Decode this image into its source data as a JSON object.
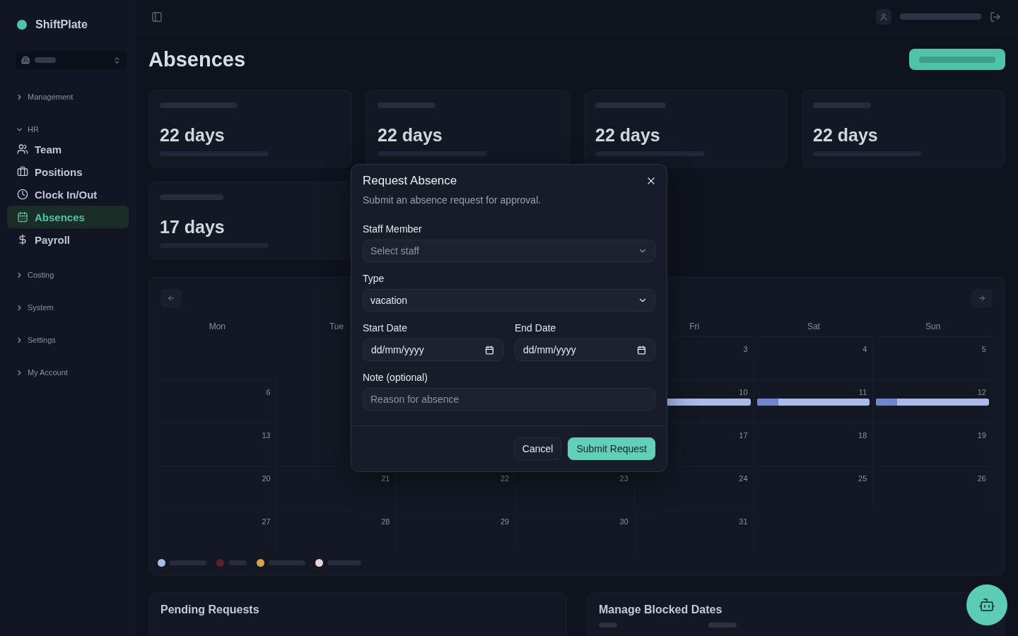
{
  "sidebar": {
    "brand": "ShiftPlate",
    "groups": [
      {
        "label": "Management",
        "expanded": false
      },
      {
        "label": "HR",
        "expanded": true,
        "items": [
          {
            "label": "Team",
            "selected": false
          },
          {
            "label": "Positions",
            "selected": false
          },
          {
            "label": "Clock In/Out",
            "selected": false
          },
          {
            "label": "Absences",
            "selected": true
          },
          {
            "label": "Payroll",
            "selected": false
          }
        ]
      },
      {
        "label": "Costing",
        "expanded": false
      },
      {
        "label": "System",
        "expanded": false
      },
      {
        "label": "Settings",
        "expanded": false
      },
      {
        "label": "My Account",
        "expanded": false
      }
    ]
  },
  "page": {
    "title": "Absences"
  },
  "balances": [
    {
      "days": "22 days"
    },
    {
      "days": "22 days"
    },
    {
      "days": "22 days"
    },
    {
      "days": "22 days"
    },
    {
      "days": "17 days"
    }
  ],
  "calendar": {
    "weekdays": {
      "mon": "Mon",
      "tue": "Tue",
      "fri": "Fri",
      "sat": "Sat",
      "sun": "Sun"
    },
    "weeks": [
      {
        "cells": [
          null,
          null,
          null,
          null,
          {
            "day": "3",
            "kind": "plain"
          },
          {
            "day": "4",
            "kind": "plain"
          },
          {
            "day": "5",
            "kind": "plain"
          }
        ]
      },
      {
        "cells": [
          {
            "day": "6",
            "kind": "plain"
          },
          null,
          null,
          null,
          {
            "day": "10",
            "kind": "vacation"
          },
          {
            "day": "11",
            "kind": "vacation"
          },
          {
            "day": "12",
            "kind": "vacation"
          }
        ]
      },
      {
        "cells": [
          {
            "day": "13",
            "kind": "plain"
          },
          null,
          null,
          null,
          {
            "day": "17",
            "kind": "plain"
          },
          {
            "day": "18",
            "kind": "plain"
          },
          {
            "day": "19",
            "kind": "plain"
          }
        ]
      },
      {
        "cells": [
          {
            "day": "20",
            "kind": "plain"
          },
          {
            "day": "21",
            "kind": "plain"
          },
          {
            "day": "22",
            "kind": "plain"
          },
          {
            "day": "23",
            "kind": "plain"
          },
          {
            "day": "24",
            "kind": "plain"
          },
          {
            "day": "25",
            "kind": "plain"
          },
          {
            "day": "26",
            "kind": "plain"
          }
        ]
      },
      {
        "cells": [
          {
            "day": "27",
            "kind": "plain"
          },
          {
            "day": "28",
            "kind": "plain"
          },
          {
            "day": "29",
            "kind": "plain"
          },
          {
            "day": "30",
            "kind": "plain"
          },
          {
            "day": "31",
            "kind": "plain"
          },
          null,
          null
        ]
      }
    ],
    "legend": [
      {
        "kind": "vacation",
        "color": "#a9bbe6"
      },
      {
        "kind": "sick",
        "color": "#5c2126"
      },
      {
        "kind": "personal",
        "color": "#d9a24a"
      },
      {
        "kind": "blocked",
        "color": "#e6d3d3"
      }
    ]
  },
  "panels": [
    {
      "kind": "list",
      "title": "Pending Requests"
    },
    {
      "kind": "table",
      "title": "Manage Blocked Dates"
    }
  ],
  "dialog": {
    "title": "Request Absence",
    "description": "Submit an absence request for approval.",
    "fields": [
      {
        "kind": "select",
        "label": "Staff Member",
        "placeholder": "Select staff"
      },
      {
        "kind": "select",
        "label": "Type",
        "value": "vacation"
      },
      {
        "kind": "date",
        "label": "Start Date",
        "placeholder": "dd/mm/yyyy"
      },
      {
        "kind": "date",
        "label": "End Date",
        "placeholder": "dd/mm/yyyy"
      },
      {
        "kind": "text",
        "label": "Note (optional)",
        "placeholder": "Reason for absence"
      }
    ],
    "buttons": [
      {
        "kind": "secondary",
        "label": "Cancel"
      },
      {
        "kind": "primary",
        "label": "Submit Request"
      }
    ]
  }
}
